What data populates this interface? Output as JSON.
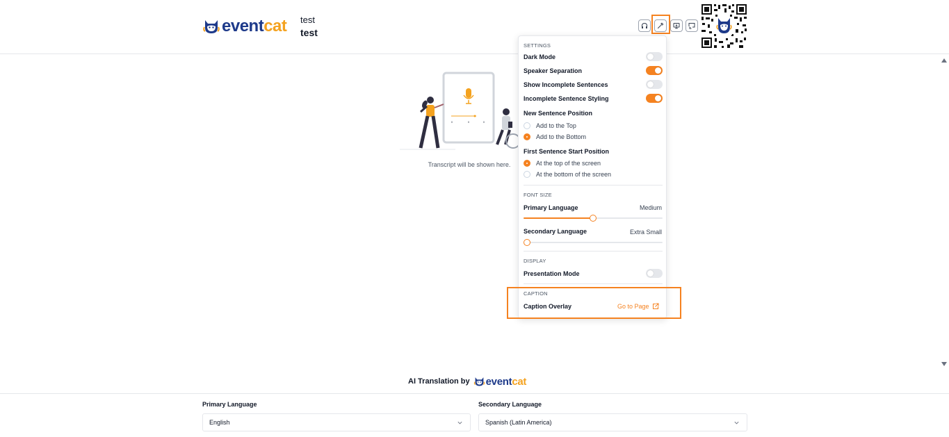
{
  "header": {
    "logo_prefix": "event",
    "logo_suffix": "cat",
    "event_title_line1": "test",
    "event_title_line2": "test",
    "buttons": [
      "headphones-icon",
      "wrench-icon",
      "monitor-icon",
      "screen-share-icon"
    ]
  },
  "main": {
    "transcript_placeholder": "Transcript will be shown here."
  },
  "settings": {
    "section_title": "SETTINGS",
    "dark_mode": {
      "label": "Dark Mode",
      "on": false
    },
    "speaker_separation": {
      "label": "Speaker Separation",
      "on": true
    },
    "show_incomplete": {
      "label": "Show Incomplete Sentences",
      "on": false
    },
    "incomplete_styling": {
      "label": "Incomplete Sentence Styling",
      "on": true
    },
    "new_sentence_position": {
      "label": "New Sentence Position",
      "options": [
        "Add to the Top",
        "Add to the Bottom"
      ],
      "selected": "Add to the Bottom"
    },
    "first_sentence_position": {
      "label": "First Sentence Start Position",
      "options": [
        "At the top of the screen",
        "At the bottom of the screen"
      ],
      "selected": "At the top of the screen"
    }
  },
  "font_size": {
    "section_title": "FONT SIZE",
    "primary": {
      "label": "Primary Language",
      "value": "Medium",
      "level": 0.5
    },
    "secondary": {
      "label": "Secondary Language",
      "value": "Extra Small",
      "level": 0.0
    }
  },
  "display": {
    "section_title": "DISPLAY",
    "presentation_mode": {
      "label": "Presentation Mode",
      "on": false
    }
  },
  "caption": {
    "section_title": "CAPTION",
    "overlay_label": "Caption Overlay",
    "goto_label": "Go to Page"
  },
  "footer": {
    "ai_translation_by": "AI Translation by",
    "brand_prefix": "event",
    "brand_suffix": "cat",
    "primary_language_label": "Primary Language",
    "primary_language_value": "English",
    "secondary_language_label": "Secondary Language",
    "secondary_language_value": "Spanish (Latin America)"
  },
  "colors": {
    "accent": "#f58220",
    "brand_blue": "#1e3a8a",
    "brand_orange": "#f4a21f"
  }
}
